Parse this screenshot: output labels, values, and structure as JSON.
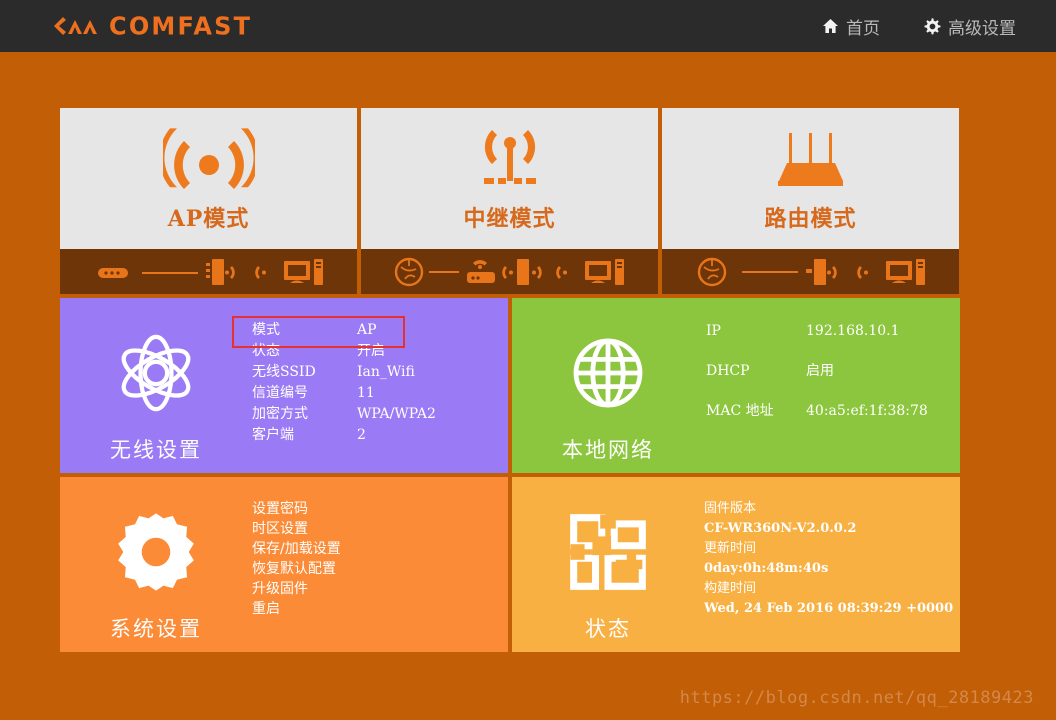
{
  "header": {
    "brand": "COMFAST",
    "brand_color": "#ee6f1e",
    "bar_color": "#2b2b2b",
    "nav": [
      {
        "label": "首页",
        "icon": "home-icon"
      },
      {
        "label": "高级设置",
        "icon": "gear-icon"
      }
    ]
  },
  "modes": [
    {
      "label": "AP模式",
      "icon": "wifi-signal-icon",
      "diagram": "modem-line-ap-wifi-pc"
    },
    {
      "label": "中继模式",
      "icon": "antenna-tower-icon",
      "diagram": "globe-line-router-wifi-ap-wifi-pc"
    },
    {
      "label": "路由模式",
      "icon": "router-antennas-icon",
      "diagram": "globe-line-ap-wifi-pc"
    }
  ],
  "wireless": {
    "title": "无线设置",
    "icon": "atom-icon",
    "bg": "#9b7bf5",
    "rows": [
      {
        "key": "模式",
        "value": "AP",
        "highlight": true
      },
      {
        "key": "状态",
        "value": "开启",
        "highlight": false
      },
      {
        "key": "无线SSID",
        "value": "Ian_Wifi",
        "highlight": false
      },
      {
        "key": "信道编号",
        "value": "11",
        "highlight": false
      },
      {
        "key": "加密方式",
        "value": "WPA/WPA2",
        "highlight": false
      },
      {
        "key": "客户端",
        "value": "2",
        "highlight": false
      }
    ],
    "highlight_color": "#e8302e"
  },
  "network": {
    "title": "本地网络",
    "icon": "globe-icon",
    "bg": "#8cc63e",
    "rows": [
      {
        "key": "IP",
        "value": "192.168.10.1"
      },
      {
        "key": "DHCP",
        "value": "启用"
      },
      {
        "key": "MAC 地址",
        "value": "40:a5:ef:1f:38:78"
      }
    ]
  },
  "system": {
    "title": "系统设置",
    "icon": "gear-icon",
    "bg": "#fb8b36",
    "items": [
      "设置密码",
      "时区设置",
      "保存/加载设置",
      "恢复默认配置",
      "升级固件",
      "重启"
    ]
  },
  "status": {
    "title": "状态",
    "icon": "four-squares-icon",
    "bg": "#f9b043",
    "lines": [
      {
        "text": "固件版本",
        "kind": "label"
      },
      {
        "text": "CF-WR360N-V2.0.0.2",
        "kind": "value"
      },
      {
        "text": "更新时间",
        "kind": "label"
      },
      {
        "text": "0day:0h:48m:40s",
        "kind": "value"
      },
      {
        "text": "构建时间",
        "kind": "label"
      },
      {
        "text": "Wed, 24 Feb 2016 08:39:29 +0000",
        "kind": "value"
      }
    ]
  },
  "watermark": "https://blog.csdn.net/qq_28189423",
  "page_bg": "#c25e06"
}
